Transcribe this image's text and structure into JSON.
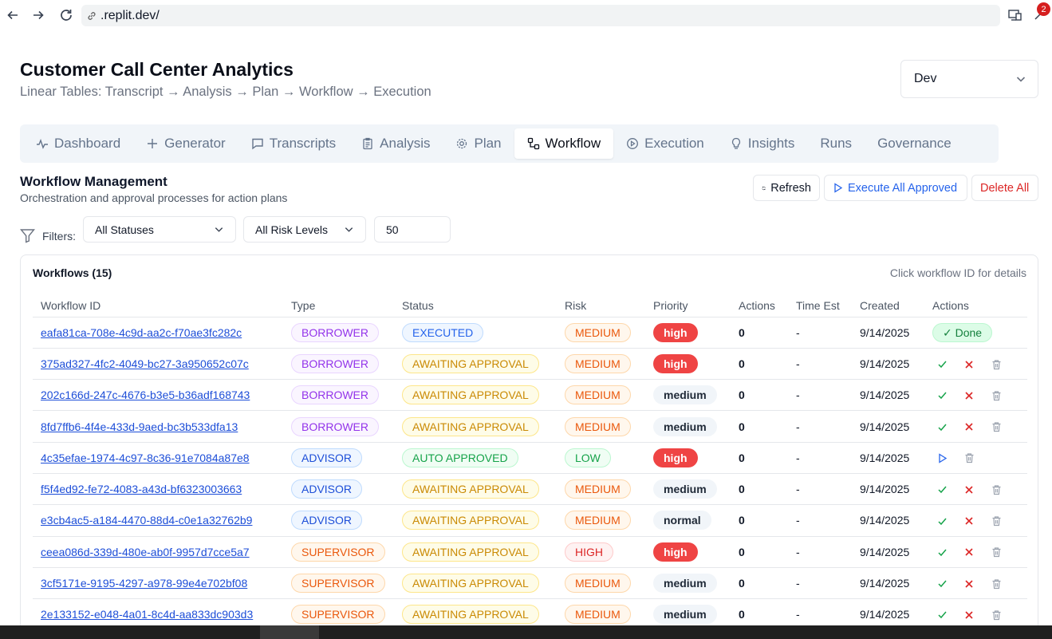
{
  "browser": {
    "url": ".replit.dev/",
    "extension_badge": "2"
  },
  "header": {
    "title": "Customer Call Center Analytics",
    "subtitle": "Linear Tables: Transcript → Analysis → Plan → Workflow → Execution",
    "env_select": "Dev"
  },
  "tabs": [
    {
      "label": "Dashboard",
      "icon": "activity-icon"
    },
    {
      "label": "Generator",
      "icon": "plus-icon"
    },
    {
      "label": "Transcripts",
      "icon": "message-square-icon"
    },
    {
      "label": "Analysis",
      "icon": "clipboard-icon"
    },
    {
      "label": "Plan",
      "icon": "gear-icon"
    },
    {
      "label": "Workflow",
      "icon": "workflow-icon",
      "active": true
    },
    {
      "label": "Execution",
      "icon": "play-circle-icon"
    },
    {
      "label": "Insights",
      "icon": "lightbulb-icon"
    },
    {
      "label": "Runs",
      "icon": ""
    },
    {
      "label": "Governance",
      "icon": ""
    }
  ],
  "section": {
    "title": "Workflow Management",
    "description": "Orchestration and approval processes for action plans",
    "refresh_label": "Refresh",
    "execute_label": "Execute All Approved",
    "delete_label": "Delete All"
  },
  "filters": {
    "label": "Filters:",
    "status": "All Statuses",
    "risk": "All Risk Levels",
    "limit": "50"
  },
  "card": {
    "title": "Workflows (15)",
    "hint": "Click workflow ID for details"
  },
  "table": {
    "columns": [
      "Workflow ID",
      "Type",
      "Status",
      "Risk",
      "Priority",
      "Actions",
      "Time Est",
      "Created",
      "Actions"
    ],
    "rows": [
      {
        "id": "eafa81ca-708e-4c9d-aa2c-f70ae3fc282c",
        "type": "BORROWER",
        "status": "EXECUTED",
        "risk": "MEDIUM",
        "priority": "high",
        "actions": "0",
        "time": "-",
        "created": "9/14/2025",
        "action_set": "done",
        "done_label": "✓ Done"
      },
      {
        "id": "375ad327-4fc2-4049-bc27-3a950652c07c",
        "type": "BORROWER",
        "status": "AWAITING APPROVAL",
        "risk": "MEDIUM",
        "priority": "high",
        "actions": "0",
        "time": "-",
        "created": "9/14/2025",
        "action_set": "approve"
      },
      {
        "id": "202c166d-247c-4676-b3e5-b36adf168743",
        "type": "BORROWER",
        "status": "AWAITING APPROVAL",
        "risk": "MEDIUM",
        "priority": "medium",
        "actions": "0",
        "time": "-",
        "created": "9/14/2025",
        "action_set": "approve"
      },
      {
        "id": "8fd7ffb6-4f4e-433d-9aed-bc3b533dfa13",
        "type": "BORROWER",
        "status": "AWAITING APPROVAL",
        "risk": "MEDIUM",
        "priority": "medium",
        "actions": "0",
        "time": "-",
        "created": "9/14/2025",
        "action_set": "approve"
      },
      {
        "id": "4c35efae-1974-4c97-8c36-91e7084a87e8",
        "type": "ADVISOR",
        "status": "AUTO APPROVED",
        "risk": "LOW",
        "priority": "high",
        "actions": "0",
        "time": "-",
        "created": "9/14/2025",
        "action_set": "execute"
      },
      {
        "id": "f5f4ed92-fe72-4083-a43d-bf6323003663",
        "type": "ADVISOR",
        "status": "AWAITING APPROVAL",
        "risk": "MEDIUM",
        "priority": "medium",
        "actions": "0",
        "time": "-",
        "created": "9/14/2025",
        "action_set": "approve"
      },
      {
        "id": "e3cb4ac5-a184-4470-88d4-c0e1a32762b9",
        "type": "ADVISOR",
        "status": "AWAITING APPROVAL",
        "risk": "MEDIUM",
        "priority": "normal",
        "actions": "0",
        "time": "-",
        "created": "9/14/2025",
        "action_set": "approve"
      },
      {
        "id": "ceea086d-339d-480e-ab0f-9957d7cce5a7",
        "type": "SUPERVISOR",
        "status": "AWAITING APPROVAL",
        "risk": "HIGH",
        "priority": "high",
        "actions": "0",
        "time": "-",
        "created": "9/14/2025",
        "action_set": "approve"
      },
      {
        "id": "3cf5171e-9195-4297-a978-99e4e702bf08",
        "type": "SUPERVISOR",
        "status": "AWAITING APPROVAL",
        "risk": "MEDIUM",
        "priority": "medium",
        "actions": "0",
        "time": "-",
        "created": "9/14/2025",
        "action_set": "approve"
      },
      {
        "id": "2e133152-e048-4a01-8c4d-aa833dc903d3",
        "type": "SUPERVISOR",
        "status": "AWAITING APPROVAL",
        "risk": "MEDIUM",
        "priority": "medium",
        "actions": "0",
        "time": "-",
        "created": "9/14/2025",
        "action_set": "approve"
      }
    ]
  },
  "colors": {
    "link": "#1d4ed8",
    "danger": "#dc2626",
    "success": "#16a34a",
    "primary": "#2563eb"
  }
}
